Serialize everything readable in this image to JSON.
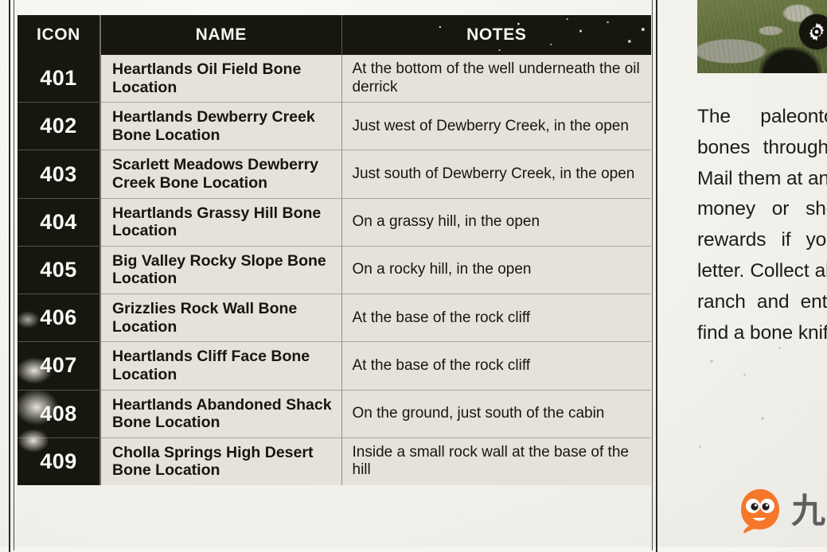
{
  "table": {
    "headers": [
      "ICON",
      "NAME",
      "NOTES"
    ],
    "rows": [
      {
        "icon": "401",
        "name": "Heartlands Oil Field Bone Location",
        "notes": "At the bottom of the well underneath the oil derrick"
      },
      {
        "icon": "402",
        "name": "Heartlands Dewberry Creek Bone Location",
        "notes": "Just west of Dewberry Creek, in the open"
      },
      {
        "icon": "403",
        "name": "Scarlett Meadows Dewberry Creek Bone Location",
        "notes": "Just south of Dewberry Creek, in the open"
      },
      {
        "icon": "404",
        "name": "Heartlands Grassy Hill Bone Location",
        "notes": "On a grassy hill, in the open"
      },
      {
        "icon": "405",
        "name": "Big Valley Rocky Slope Bone Location",
        "notes": "On a rocky hill, in the open"
      },
      {
        "icon": "406",
        "name": "Grizzlies Rock Wall Bone Location",
        "notes": "At the base of the rock cliff"
      },
      {
        "icon": "407",
        "name": "Heartlands Cliff Face Bone Location",
        "notes": "At the base of the rock cliff"
      },
      {
        "icon": "408",
        "name": "Heartlands Abandoned Shack Bone Location",
        "notes": "On the ground, just south of the cabin"
      },
      {
        "icon": "409",
        "name": "Cholla Springs High Desert Bone Location",
        "notes": "Inside a small rock wall at the base of the hill"
      }
    ]
  },
  "right_panel": {
    "photo_caption": "",
    "gear_icon": "gear-icon",
    "body_text": "The paleontologist wants bones throughout the world. Mail them at any post office for money or she will provide rewards if you mail you a letter. Collect all of them to her ranch and enter the barn to find a bone knife."
  },
  "watermark": {
    "text": "九游",
    "mascot": "jiuyou-mascot-icon"
  },
  "colors": {
    "header_black": "#17170f",
    "parchment": "#e5e2da",
    "page_background": "#f6f5f1",
    "text_dark": "#16160f",
    "mascot_orange": "#f5772a"
  }
}
